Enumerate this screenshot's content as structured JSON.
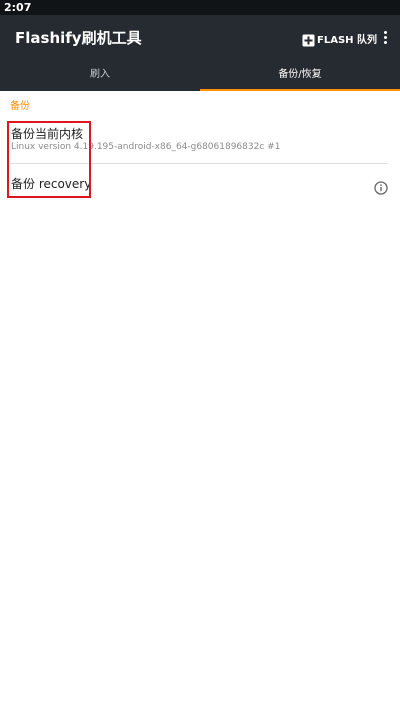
{
  "status_bar": {
    "time": "2:07"
  },
  "app_bar": {
    "title": "Flashify刷机工具",
    "flash_queue_label": "FLASH 队列"
  },
  "tabs": [
    {
      "label": "刷入",
      "active": false
    },
    {
      "label": "备份/恢复",
      "active": true
    }
  ],
  "section": {
    "header": "备份",
    "items": [
      {
        "title": "备份当前内核",
        "summary": "Linux version 4.19.195-android-x86_64-g68061896832c #1"
      },
      {
        "title": "备份 recovery"
      }
    ]
  },
  "colors": {
    "accent": "#ff8f00",
    "toolbar": "#262b31",
    "status_bar": "#111417",
    "highlight": "#e0161d"
  }
}
